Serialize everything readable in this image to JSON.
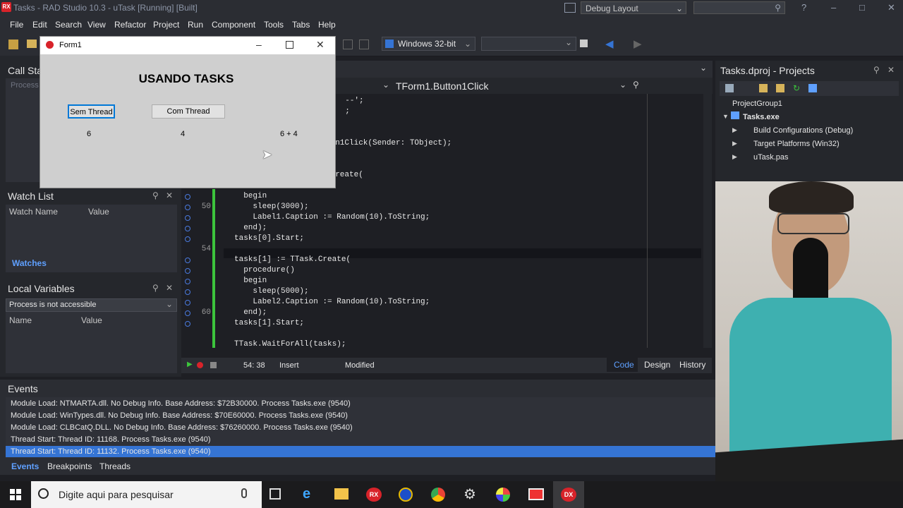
{
  "window": {
    "title": "Tasks - RAD Studio 10.3 - uTask [Running] [Built]",
    "layout": "Debug Layout",
    "app_icon_text": "RX"
  },
  "menu": [
    "File",
    "Edit",
    "Search",
    "View",
    "Refactor",
    "Project",
    "Run",
    "Component",
    "Tools",
    "Tabs",
    "Help"
  ],
  "toolbar": {
    "platform": "Windows 32-bit"
  },
  "call_stack": {
    "title": "Call Stack",
    "placeholder": "Process"
  },
  "watch_list": {
    "title": "Watch List",
    "col_name": "Watch Name",
    "col_value": "Value",
    "tab": "Watches"
  },
  "local_vars": {
    "title": "Local Variables",
    "process": "Process is not accessible",
    "col_name": "Name",
    "col_value": "Value"
  },
  "editor": {
    "method_select": "TForm1.Button1Click",
    "line_numbers": [
      "50",
      "54",
      "60"
    ],
    "code": [
      "  --';",
      "  ;",
      "",
      "  n1Click(Sender: TObject);",
      "",
      "",
      "  reate(",
      "",
      "  begin",
      "    sleep(3000);",
      "    Label1.Caption := Random(10).ToString;",
      "  end);",
      "tasks[0].Start;",
      "",
      "tasks[1] := TTask.Create(",
      "  procedure()",
      "  begin",
      "    sleep(5000);",
      "    Label2.Caption := Random(10).ToString;",
      "  end);",
      "tasks[1].Start;",
      "",
      "TTask.WaitForAll(tasks);"
    ],
    "status": {
      "position": "54: 38",
      "mode": "Insert",
      "state": "Modified"
    },
    "tabs": [
      "Code",
      "Design",
      "History"
    ]
  },
  "form": {
    "title": "Form1",
    "heading": "USANDO TASKS",
    "btn_sem": "Sem Thread",
    "btn_com": "Com Thread",
    "label1": "6",
    "label2": "4",
    "label3": "6 + 4"
  },
  "projects": {
    "title": "Tasks.dproj - Projects",
    "tree": [
      "ProjectGroup1",
      "Tasks.exe",
      "Build Configurations (Debug)",
      "Target Platforms (Win32)",
      "uTask.pas"
    ]
  },
  "events": {
    "title": "Events",
    "lines": [
      "Module Load: NTMARTA.dll. No Debug Info. Base Address: $72B30000. Process Tasks.exe (9540)",
      "Module Load: WinTypes.dll. No Debug Info. Base Address: $70E60000. Process Tasks.exe (9540)",
      "Module Load: CLBCatQ.DLL. No Debug Info. Base Address: $76260000. Process Tasks.exe (9540)",
      "Thread Start: Thread ID: 11168. Process Tasks.exe (9540)",
      "Thread Start: Thread ID: 11132. Process Tasks.exe (9540)"
    ],
    "tabs": [
      "Events",
      "Breakpoints",
      "Threads"
    ]
  },
  "taskbar": {
    "search": "Digite aqui para pesquisar"
  },
  "colors": {
    "accent": "#3574d4",
    "selection": "#3574d4",
    "breakpoint": "#d8232a",
    "green_bar": "#3cc43c"
  }
}
